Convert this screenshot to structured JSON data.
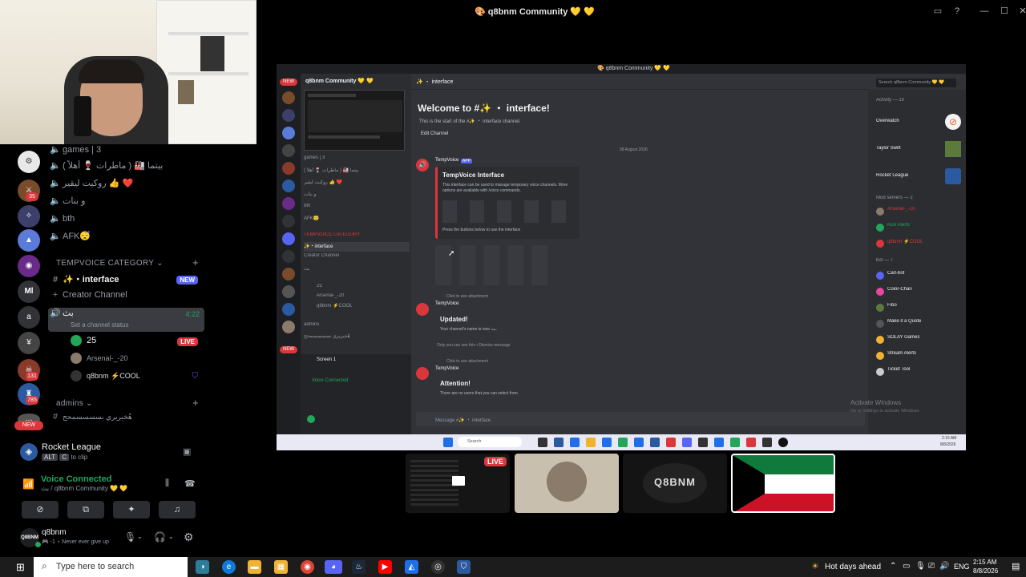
{
  "window": {
    "title": "🎨 q8bnm Community 💛 💛"
  },
  "channels": {
    "games": "games | 3",
    "ch1": "بيتما 🏭 ( ماطرات 🍷 أهلاً )",
    "ch2": "روكيت ليقير 👍 ❤️",
    "ch3": "و بنات",
    "bth": "bth",
    "afk": "AFK😴",
    "category": "TEMPVOICE CATEGORY",
    "interface": "✨・interface",
    "new_badge": "NEW",
    "creator": "Creator Channel",
    "voice_name": "بث",
    "voice_time": "4:22",
    "voice_status": "Set a channel status",
    "members": [
      {
        "name": "25",
        "badge": "LIVE"
      },
      {
        "name": "Arsenal-_-20"
      },
      {
        "name": "q8bnm ⚡COOL"
      }
    ],
    "admins_cat": "admins",
    "last_channel": "هٌخبريري بسسسسمحح"
  },
  "guild_badges": {
    "g1": "35",
    "g2": "131",
    "g3": "785",
    "ml": "Ml",
    "a": "a",
    "new": "NEW"
  },
  "game": {
    "name": "Rocket League",
    "hint_key1": "ALT",
    "hint_key2": "C",
    "hint_text": "to clip"
  },
  "voice": {
    "status": "Voice Connected",
    "channel": "بث / q8bnm Community 💛 💛"
  },
  "user": {
    "name": "q8bnm",
    "status": "🎮 -1 ⋆ Never ever give up"
  },
  "stream": {
    "title": "🎨 q8bnm Community 💛 💛",
    "server": "q8bnm Community 💛 💛",
    "channel_header": "✨ ・ interface",
    "search": "Search q8bnm Community 💛 💛",
    "welcome": "Welcome to #✨ ・ interface!",
    "welcome_sub": "This is the start of the #✨ ・ interface channel.",
    "edit": "Edit Channel",
    "date": "08 August 2026",
    "bot": "TempVoice",
    "app": "APP",
    "embed_title": "TempVoice Interface",
    "embed_desc": "This interface can be used to manage temporary voice channels. More options are available with /voice commands.",
    "embed_foot": "Press the buttons below to use the interface",
    "click_attach": "Click to see attachment",
    "updated": "Updated!",
    "updated_sub": "Your channel's name is now بث.",
    "only_you": "Only you can see this • Dismiss message",
    "attention": "Attention!",
    "attention_sub": "There are no users that you can select from.",
    "msg_placeholder": "Message #✨ ・ interface",
    "activate": "Activate Windows",
    "activate_sub": "Go to Settings to activate Windows.",
    "screen": "Screen 1",
    "voice_conn": "Voice Connected",
    "activity": "Activity — 10",
    "act1": "Overwatch",
    "act2": "Taylor Swift",
    "act3": "Rocket League",
    "sec_mod": "Mod servers — 2",
    "m1": "Arsenal-_-20",
    "m2": "Kick Alerts",
    "m3": "q8bnm ⚡COOL",
    "sec_bot": "bot — 7",
    "b1": "Carl-bot",
    "b2": "Color-Chan",
    "b3": "Fibo",
    "b4": "Make it a Quote",
    "b5": "SOLAY Games",
    "b6": "Stream Alerts",
    "b7": "Ticket Tool",
    "taskbar_search": "Search",
    "taskbar_time": "2:15 AM",
    "taskbar_date": "8/8/2026"
  },
  "thumbnails": {
    "live": "LIVE",
    "brand": "Q8BNM"
  },
  "taskbar": {
    "search": "Type here to search",
    "weather": "Hot days ahead",
    "lang": "ENG",
    "time": "2:15 AM",
    "date": "8/8/2026"
  }
}
